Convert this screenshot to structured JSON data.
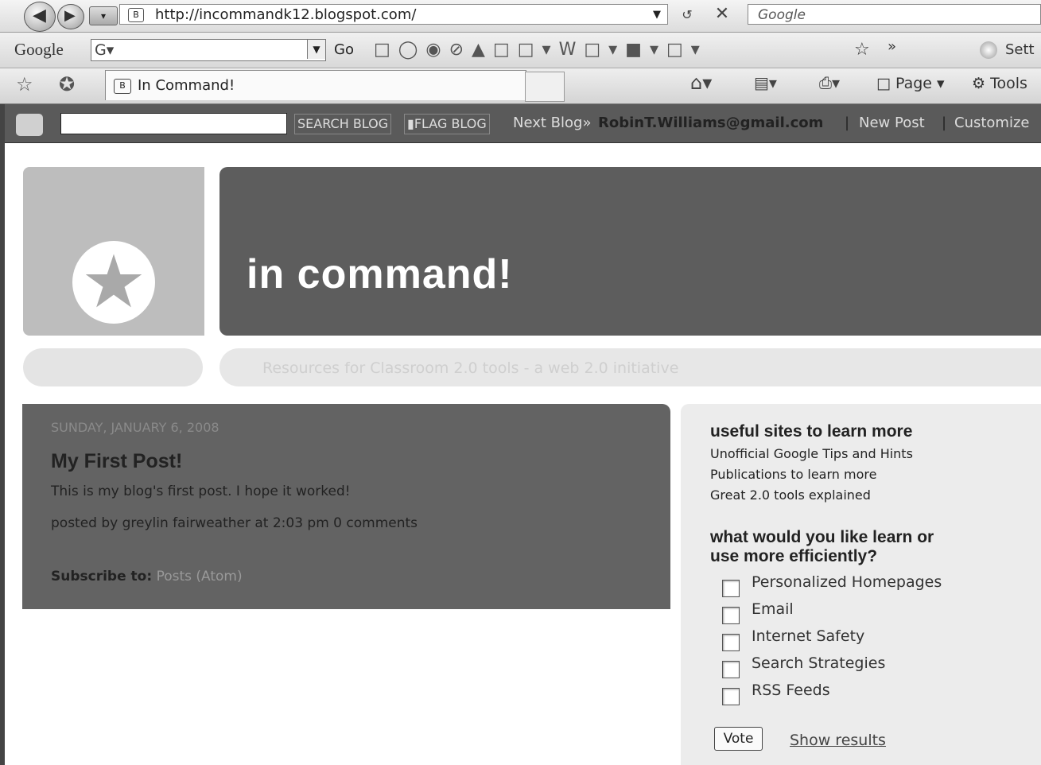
{
  "browser": {
    "url": "http://incommandk12.blogspot.com/",
    "search_placeholder": "Google",
    "tab_title": "In Command!",
    "toolbar": {
      "google_label": "Google",
      "go_label": "Go",
      "more_label": "»",
      "settings_label": "Sett",
      "page_label": "Page",
      "tools_label": "Tools"
    }
  },
  "navbar": {
    "search_button": "SEARCH BLOG",
    "flag_button": "FLAG BLOG",
    "next_blog": "Next Blog»",
    "user_email": "RobinT.Williams@gmail.com",
    "sep1": "|",
    "new_post": "New Post",
    "sep2": "|",
    "customize": "Customize"
  },
  "header": {
    "title": "in command!",
    "description": "Resources for Classroom 2.0 tools - a web 2.0 initiative"
  },
  "post": {
    "date": "SUNDAY, JANUARY 6, 2008",
    "title": "My First Post!",
    "body": "This is my blog's first post. I hope it worked!",
    "footer": "posted by greylin fairweather at 2:03 pm 0 comments",
    "subscribe_label": "Subscribe to:",
    "subscribe_link": "Posts (Atom)"
  },
  "sidebar": {
    "links_heading": "useful sites to learn more",
    "links": [
      "Unofficial Google Tips and Hints",
      "Publications to learn more",
      "Great 2.0 tools explained"
    ],
    "poll_heading_1": "what would you like learn or",
    "poll_heading_2": "use more efficiently?",
    "poll_options": [
      "Personalized Homepages",
      "Email",
      "Internet Safety",
      "Search Strategies",
      "RSS Feeds"
    ],
    "vote_button": "Vote",
    "show_results": "Show results"
  },
  "icons": [
    "back-icon",
    "forward-icon",
    "page-icon",
    "refresh-icon",
    "stop-icon",
    "star-icon",
    "favorites-icon",
    "home-icon",
    "feed-icon",
    "print-icon",
    "gear-icon",
    "blogger-logo-icon",
    "flag-icon"
  ]
}
